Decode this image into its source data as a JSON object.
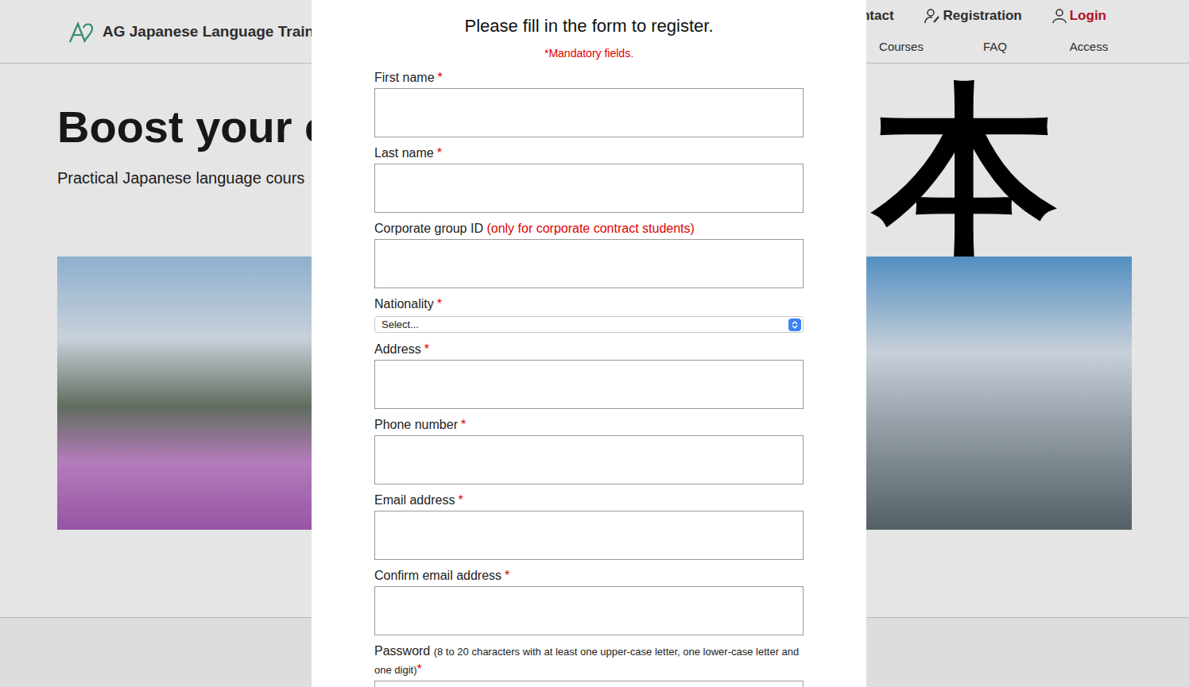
{
  "header": {
    "logo": "AG Japanese Language Trainin",
    "nav_top": [
      "ntact",
      "Registration",
      "Login"
    ],
    "nav_bottom": [
      "Courses",
      "FAQ",
      "Access"
    ]
  },
  "hero": {
    "title": "Boost your c",
    "subtitle": "Practical Japanese language cours",
    "calligraphy": "日本"
  },
  "modal": {
    "title": "Please fill in the form to register.",
    "mandatory_note": "*Mandatory fields.",
    "fields": [
      {
        "label": "First name",
        "required": true,
        "kind": "text",
        "note": ""
      },
      {
        "label": "Last name",
        "required": true,
        "kind": "text",
        "note": ""
      },
      {
        "label": "Corporate group ID",
        "required": false,
        "kind": "text",
        "note": "(only for corporate contract students)"
      },
      {
        "label": "Nationality",
        "required": true,
        "kind": "select",
        "note": "",
        "value": "Select..."
      },
      {
        "label": "Address",
        "required": true,
        "kind": "text",
        "note": ""
      },
      {
        "label": "Phone number",
        "required": true,
        "kind": "text",
        "note": ""
      },
      {
        "label": "Email address",
        "required": true,
        "kind": "text",
        "note": ""
      },
      {
        "label": "Confirm email address",
        "required": true,
        "kind": "text",
        "note": ""
      },
      {
        "label": "Password",
        "required": true,
        "kind": "password",
        "note": "(8 to 20 characters with at least one upper-case letter, one lower-case letter and one digit)"
      }
    ],
    "required_mark": "*"
  }
}
